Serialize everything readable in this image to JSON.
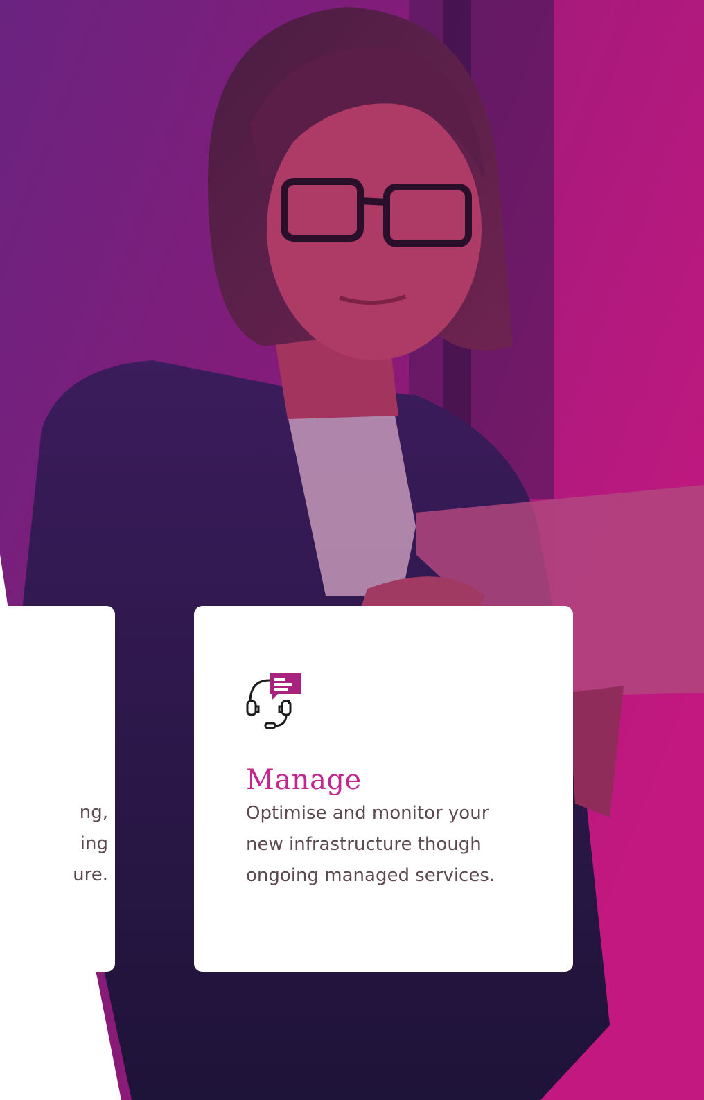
{
  "hero": {
    "overlay_colors": {
      "start": "#6a2380",
      "mid": "#8a1a78",
      "end": "#c4177f"
    }
  },
  "cards": {
    "left": {
      "text_lines": [
        "ng,",
        "ing",
        "ure."
      ]
    },
    "manage": {
      "icon": "headset-chat-icon",
      "title": "Manage",
      "description": "Optimise and monitor your new infrastructure though ongoing managed services.",
      "title_color": "#c2278f",
      "icon_accent_color": "#a8227f"
    }
  }
}
